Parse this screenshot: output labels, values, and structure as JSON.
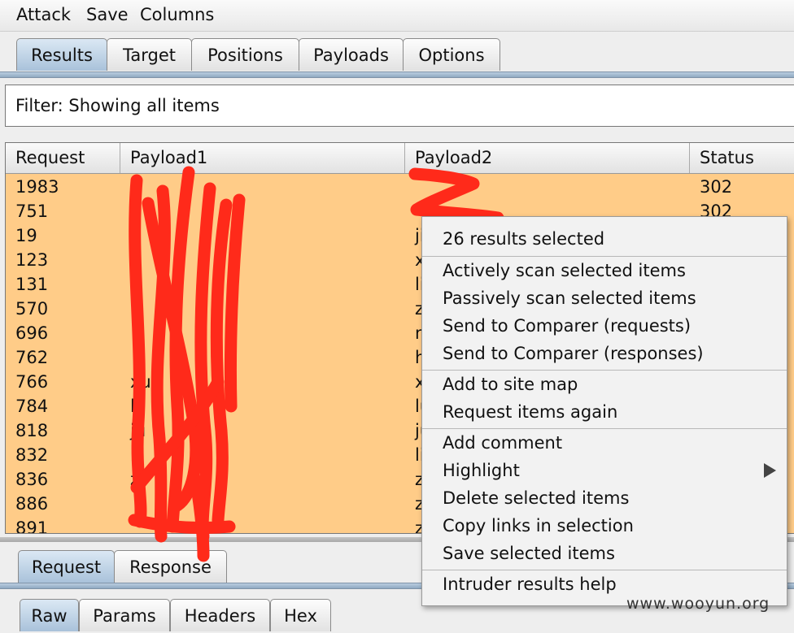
{
  "menu": [
    "Attack",
    "Save",
    "Columns"
  ],
  "main_tabs": [
    {
      "label": "Results",
      "active": true
    },
    {
      "label": "Target",
      "active": false
    },
    {
      "label": "Positions",
      "active": false
    },
    {
      "label": "Payloads",
      "active": false
    },
    {
      "label": "Options",
      "active": false
    }
  ],
  "filter": {
    "text": "Filter: Showing all items"
  },
  "table": {
    "columns": [
      "Request",
      "Payload1",
      "Payload2",
      "Status"
    ],
    "rows": [
      {
        "request": "1983",
        "payload1": "",
        "payload2": "",
        "status": "302"
      },
      {
        "request": "751",
        "payload1": "",
        "payload2": "",
        "status": "302"
      },
      {
        "request": "19",
        "payload1": "",
        "payload2": "ji",
        "status": ""
      },
      {
        "request": "123",
        "payload1": "",
        "payload2": "x",
        "status": ""
      },
      {
        "request": "131",
        "payload1": "",
        "payload2": "li",
        "status": ""
      },
      {
        "request": "570",
        "payload1": "",
        "payload2": "z",
        "status": ""
      },
      {
        "request": "696",
        "payload1": "",
        "payload2": "n",
        "status": ""
      },
      {
        "request": "762",
        "payload1": "",
        "payload2": "h",
        "status": ""
      },
      {
        "request": "766",
        "payload1": "xu",
        "payload2": "x",
        "status": ""
      },
      {
        "request": "784",
        "payload1": "lu",
        "payload2": "lu",
        "status": ""
      },
      {
        "request": "818",
        "payload1": "ju",
        "payload2": "ju",
        "status": ""
      },
      {
        "request": "832",
        "payload1": "li",
        "payload2": "li",
        "status": ""
      },
      {
        "request": "836",
        "payload1": "z",
        "payload2": "z",
        "status": ""
      },
      {
        "request": "886",
        "payload1": "",
        "payload2": "z",
        "status": ""
      },
      {
        "request": "891",
        "payload1": "",
        "payload2": "z",
        "status": ""
      }
    ]
  },
  "bottom_tabs": [
    {
      "label": "Request",
      "active": true
    },
    {
      "label": "Response",
      "active": false
    }
  ],
  "view_tabs": [
    {
      "label": "Raw",
      "active": true
    },
    {
      "label": "Params",
      "active": false
    },
    {
      "label": "Headers",
      "active": false
    },
    {
      "label": "Hex",
      "active": false
    }
  ],
  "context_menu": {
    "header": "26 results selected",
    "groups": [
      [
        "Actively scan selected items",
        "Passively scan selected items",
        "Send to Comparer (requests)",
        "Send to Comparer (responses)"
      ],
      [
        "Add to site map",
        "Request items again"
      ],
      [
        "Add comment",
        "Highlight",
        "Delete selected items",
        "Copy links in selection",
        "Save selected items"
      ],
      [
        "Intruder results help"
      ]
    ]
  },
  "watermark": "www.wooyun.org",
  "colors": {
    "row_highlight": "#ffcc88",
    "redaction": "#ff2a1a",
    "active_tab": "#a9c2da"
  }
}
